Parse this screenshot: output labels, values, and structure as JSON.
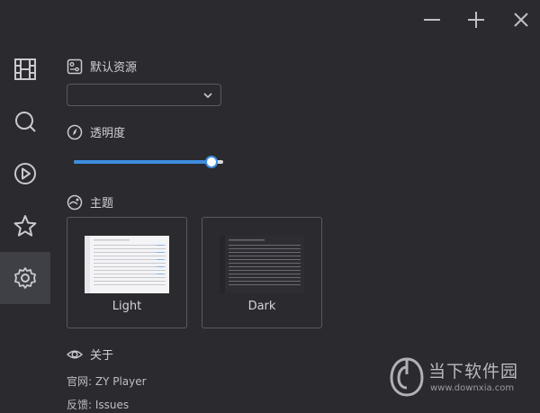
{
  "window": {
    "controls": [
      "minimize-icon",
      "maximize-icon",
      "close-icon"
    ]
  },
  "sidebar": {
    "items": [
      {
        "icon": "film-grid-icon",
        "active": false
      },
      {
        "icon": "search-icon",
        "active": false
      },
      {
        "icon": "play-circle-icon",
        "active": false
      },
      {
        "icon": "star-icon",
        "active": false
      },
      {
        "icon": "gear-icon",
        "active": true
      }
    ]
  },
  "settings": {
    "source": {
      "label": "默认资源",
      "icon": "source-icon",
      "value": ""
    },
    "opacity": {
      "label": "透明度",
      "icon": "compass-icon",
      "value_percent": 92
    },
    "theme": {
      "label": "主题",
      "icon": "palette-icon",
      "options": [
        "Light",
        "Dark"
      ]
    },
    "about": {
      "label": "关于",
      "icon": "eye-icon",
      "website": "官网: ZY Player",
      "feedback": "反馈: Issues"
    }
  },
  "watermark": {
    "name": "当下软件园",
    "url": "www.downxia.com"
  },
  "colors": {
    "background": "#2a2a2f",
    "accent": "#3d8ddf",
    "active_nav": "#3f3f46"
  }
}
